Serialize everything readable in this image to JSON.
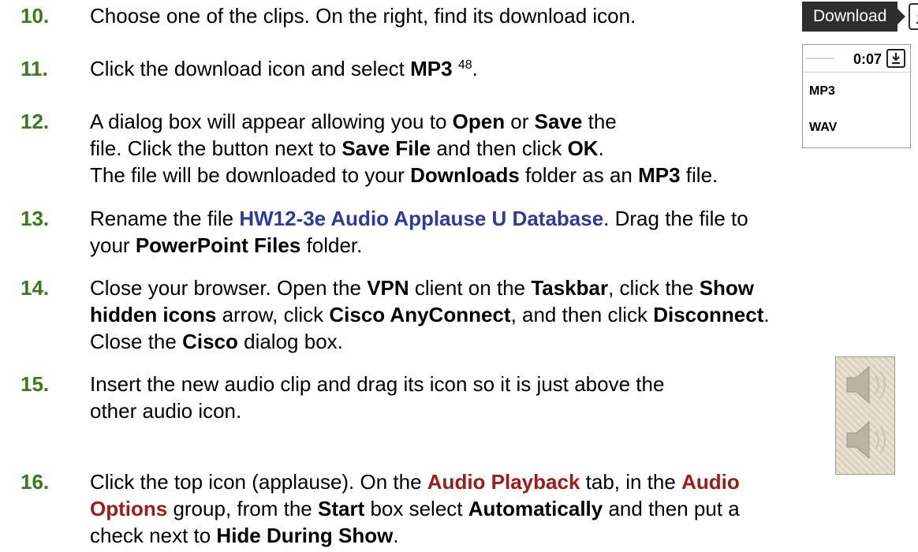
{
  "steps": [
    {
      "num": "10.",
      "l1a": "Choose one of the clips. On the right, find its download icon."
    },
    {
      "num": "11.",
      "l1a": "Click the download icon and select ",
      "l1b": "MP3",
      "sup": "48",
      "l1c": "."
    },
    {
      "num": "12.",
      "l1a": "A dialog box will appear allowing you to ",
      "open": "Open",
      "or": " or ",
      "save": "Save",
      "the": " the",
      "l2a": "file. Click the button next to ",
      "savefile": "Save File",
      "l2b": " and then click ",
      "ok": "OK",
      "l2c": ".",
      "l3a": "The file will be downloaded to your ",
      "downloads": "Downloads",
      "l3b": " folder as an ",
      "mp3": "MP3",
      "l3c": " file."
    },
    {
      "num": "13.",
      "l1a": "Rename the file ",
      "fname": "HW12-3e Audio Applause U Database",
      "l1b": ". Drag the file to",
      "l2a": "your ",
      "ppfiles": "PowerPoint Files",
      "l2b": " folder."
    },
    {
      "num": "14.",
      "l1a": "Close your browser. Open the ",
      "vpn": "VPN",
      "l1b": " client on the ",
      "taskbar": "Taskbar",
      "l1c": ", click the ",
      "show": "Show",
      "hidden": "hidden icons",
      "l2a": " arrow, click ",
      "cisco_any": "Cisco AnyConnect",
      "l2b": ", and then click ",
      "disconnect": "Disconnect",
      "l2c": ".",
      "l3a": "Close the ",
      "cisco": "Cisco",
      "l3b": " dialog box."
    },
    {
      "num": "15.",
      "l1a": "Insert the new audio clip and drag its icon so it is just above the",
      "l2a": "other audio icon."
    },
    {
      "num": "16.",
      "l1a": "Click the top icon (applause). On the ",
      "audio_pb": "Audio Playback",
      "l1b": " tab, in the ",
      "audio": "Audio",
      "options": "Options",
      "l2a": " group, from the ",
      "start": "Start",
      "l2b": " box select ",
      "auto": "Automatically",
      "l2c": " and then put a",
      "l3a": "check next to ",
      "hide": "Hide During Show",
      "l3b": "."
    }
  ],
  "download_button": {
    "label": "Download",
    "icon": "download-icon"
  },
  "dropdown": {
    "time": "0:07",
    "options": [
      "MP3",
      "WAV"
    ]
  },
  "colors": {
    "step_number": "#3a7a1c",
    "file_name": "#2f3a9e",
    "tab_name": "#a01a1a"
  }
}
